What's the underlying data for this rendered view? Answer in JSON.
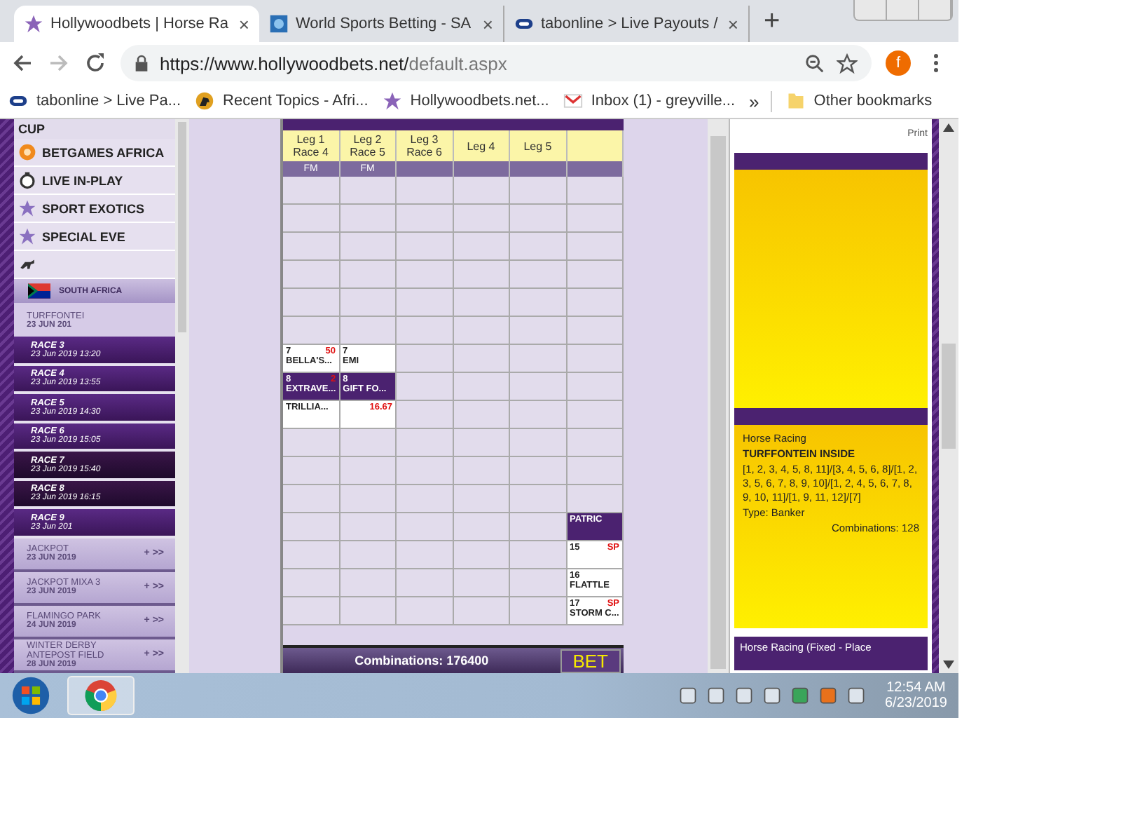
{
  "browser": {
    "tabs": [
      {
        "title": "Hollywoodbets | Horse Ra",
        "kind": "star",
        "selected": true
      },
      {
        "title": "World Sports Betting - SA",
        "kind": "globe",
        "selected": false
      },
      {
        "title": "tabonline > Live Payouts /",
        "kind": "tab",
        "selected": false
      }
    ],
    "close": "×",
    "new_tab": "+",
    "url_host": "https://www.hollywoodbets.net/",
    "url_path": "default.aspx",
    "profile": "f",
    "bookmarks": [
      {
        "label": "tabonline > Live Pa...",
        "kind": "tab"
      },
      {
        "label": "Recent Topics - Afri...",
        "kind": "horse"
      },
      {
        "label": "Hollywoodbets.net...",
        "kind": "star"
      },
      {
        "label": "Inbox (1) - greyville...",
        "kind": "mail"
      }
    ],
    "overflow": "»",
    "other_bookmarks": "Other bookmarks"
  },
  "sidebar": {
    "heading": "CUP",
    "menu": [
      {
        "label": "BETGAMES AFRICA",
        "kind": "betgames"
      },
      {
        "label": "LIVE IN-PLAY",
        "kind": "stopwatch"
      },
      {
        "label": "SPORT EXOTICS",
        "kind": "star"
      },
      {
        "label": "SPECIAL EVE",
        "kind": "star"
      }
    ],
    "country": "SOUTH AFRICA",
    "meeting": {
      "name": "TURFFONTEI",
      "date": "23 JUN 201"
    },
    "races": [
      {
        "name": "RACE 3",
        "time": "23 Jun 2019 13:20",
        "selected": false
      },
      {
        "name": "RACE 4",
        "time": "23 Jun 2019 13:55",
        "selected": false
      },
      {
        "name": "RACE 5",
        "time": "23 Jun 2019 14:30",
        "selected": false
      },
      {
        "name": "RACE 6",
        "time": "23 Jun 2019 15:05",
        "selected": false
      },
      {
        "name": "RACE 7",
        "time": "23 Jun 2019 15:40",
        "selected": true
      },
      {
        "name": "RACE 8",
        "time": "23 Jun 2019 16:15",
        "selected": true
      },
      {
        "name": "RACE 9",
        "time": "23 Jun 201",
        "selected": false
      }
    ],
    "meetings": [
      {
        "name": "JACKPOT",
        "date": "23 JUN 2019",
        "plus": "+",
        "more": ">>"
      },
      {
        "name": "JACKPOT MIXA 3",
        "date": "23 JUN 2019",
        "plus": "+",
        "more": ">>"
      },
      {
        "name": "FLAMINGO PARK",
        "date": "24 JUN 2019",
        "plus": "+",
        "more": ">>"
      },
      {
        "name": "WINTER DERBY ANTEPOST FIELD",
        "date": "28 JUN 2019",
        "plus": "+",
        "more": ">>"
      }
    ]
  },
  "grid": {
    "columns": [
      {
        "leg": "Leg 1",
        "race": "Race 4",
        "fm": "FM"
      },
      {
        "leg": "Leg 2",
        "race": "Race 5",
        "fm": "FM"
      },
      {
        "leg": "Leg 3",
        "race": "Race 6"
      },
      {
        "leg": "Leg 4"
      },
      {
        "leg": "Leg 5"
      }
    ],
    "rows": [
      [
        {
          "kind": "blank"
        },
        {
          "kind": "blank"
        },
        {
          "kind": "blank"
        },
        {
          "kind": "blank"
        },
        {
          "kind": "blank"
        },
        {
          "kind": "blank"
        }
      ],
      [
        {
          "kind": "blank"
        },
        {
          "kind": "blank"
        },
        {
          "kind": "blank"
        },
        {
          "kind": "blank"
        },
        {
          "kind": "blank"
        },
        {
          "kind": "blank"
        }
      ],
      [
        {
          "kind": "blank"
        },
        {
          "kind": "blank"
        },
        {
          "kind": "blank"
        },
        {
          "kind": "blank"
        },
        {
          "kind": "blank"
        },
        {
          "kind": "blank"
        }
      ],
      [
        {
          "kind": "blank"
        },
        {
          "kind": "blank"
        },
        {
          "kind": "blank"
        },
        {
          "kind": "blank"
        },
        {
          "kind": "blank"
        },
        {
          "kind": "blank"
        }
      ],
      [
        {
          "kind": "blank"
        },
        {
          "kind": "blank"
        },
        {
          "kind": "blank"
        },
        {
          "kind": "blank"
        },
        {
          "kind": "blank"
        },
        {
          "kind": "blank"
        }
      ],
      [
        {
          "kind": "blank"
        },
        {
          "kind": "blank"
        },
        {
          "kind": "blank"
        },
        {
          "kind": "blank"
        },
        {
          "kind": "blank"
        },
        {
          "kind": "blank"
        }
      ],
      [
        {
          "kind": "runner",
          "number": "7",
          "odds": "50",
          "name": "BELLA'S...",
          "selected": false
        },
        {
          "kind": "runner",
          "number": "7",
          "name": "EMI",
          "selected": false
        },
        {
          "kind": "blank"
        },
        {
          "kind": "blank"
        },
        {
          "kind": "blank"
        },
        {
          "kind": "blank"
        }
      ],
      [
        {
          "kind": "runner",
          "number": "8",
          "odds": "2",
          "name": "EXTRAVE...",
          "selected": true
        },
        {
          "kind": "runner",
          "number": "8",
          "name": "GIFT FO...",
          "selected": true
        },
        {
          "kind": "blank"
        },
        {
          "kind": "blank"
        },
        {
          "kind": "blank"
        },
        {
          "kind": "blank"
        }
      ],
      [
        {
          "kind": "runner",
          "name": "TRILLIA...",
          "selected": false
        },
        {
          "kind": "runner",
          "odds": "16.67",
          "selected": false
        },
        {
          "kind": "blank"
        },
        {
          "kind": "blank"
        },
        {
          "kind": "blank"
        },
        {
          "kind": "blank"
        }
      ],
      [
        {
          "kind": "blank"
        },
        {
          "kind": "blank"
        },
        {
          "kind": "blank"
        },
        {
          "kind": "blank"
        },
        {
          "kind": "blank"
        },
        {
          "kind": "blank"
        }
      ],
      [
        {
          "kind": "blank"
        },
        {
          "kind": "blank"
        },
        {
          "kind": "blank"
        },
        {
          "kind": "blank"
        },
        {
          "kind": "blank"
        },
        {
          "kind": "blank"
        }
      ],
      [
        {
          "kind": "blank"
        },
        {
          "kind": "blank"
        },
        {
          "kind": "blank"
        },
        {
          "kind": "blank"
        },
        {
          "kind": "blank"
        },
        {
          "kind": "blank"
        }
      ],
      [
        {
          "kind": "blank"
        },
        {
          "kind": "blank"
        },
        {
          "kind": "blank"
        },
        {
          "kind": "blank"
        },
        {
          "kind": "blank"
        },
        {
          "kind": "runner",
          "name": "PATRIC",
          "selected": true
        }
      ],
      [
        {
          "kind": "blank"
        },
        {
          "kind": "blank"
        },
        {
          "kind": "blank"
        },
        {
          "kind": "blank"
        },
        {
          "kind": "blank"
        },
        {
          "kind": "runner",
          "number": "15",
          "odds": "SP",
          "selected": false
        }
      ],
      [
        {
          "kind": "blank"
        },
        {
          "kind": "blank"
        },
        {
          "kind": "blank"
        },
        {
          "kind": "blank"
        },
        {
          "kind": "blank"
        },
        {
          "kind": "runner",
          "number": "16",
          "name": "FLATTLE",
          "selected": false
        }
      ],
      [
        {
          "kind": "blank"
        },
        {
          "kind": "blank"
        },
        {
          "kind": "blank"
        },
        {
          "kind": "blank"
        },
        {
          "kind": "blank"
        },
        {
          "kind": "runner",
          "number": "17",
          "odds": "SP",
          "name": "STORM C...",
          "selected": false
        }
      ]
    ],
    "combinations": "Combinations: 176400",
    "bet": "BET"
  },
  "betslip": {
    "print": "Print",
    "bet": {
      "sport": "Horse Racing",
      "meeting": "TURFFONTEIN INSIDE",
      "selections": "[1, 2, 3, 4, 5, 8, 11]/[3, 4, 5, 6, 8]/[1, 2, 3, 5, 6, 7, 8, 9, 10]/[1, 2, 4, 5, 6, 7, 8, 9, 10, 11]/[1, 9, 11, 12]/[7]",
      "type": "Type: Banker",
      "combinations": "Combinations: 128"
    },
    "next_header": "Horse Racing (Fixed - Place"
  },
  "taskbar": {
    "time": "12:54 AM",
    "date": "6/23/2019"
  }
}
